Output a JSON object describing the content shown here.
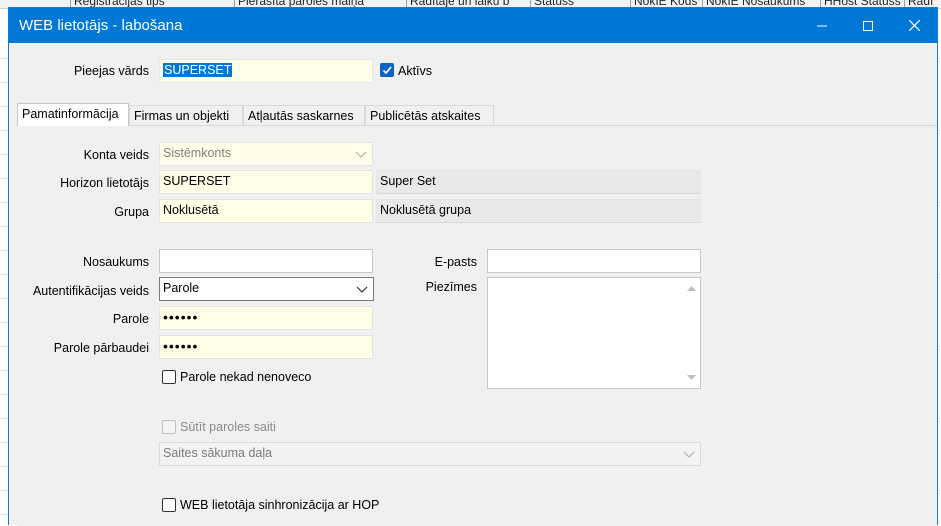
{
  "background": {
    "columns": [
      "Reģistrācijas tips",
      "Pierasītā paroles maiņa",
      "Rādītāje un laiku b",
      "Statuss",
      "NokIE Kods",
      "NokIE Nosaukums",
      "HHost Statuss",
      "Rādī"
    ]
  },
  "window": {
    "title": "WEB lietotājs - labošana"
  },
  "header": {
    "username_label": "Pieejas vārds",
    "username_value": "SUPERSET",
    "active_label": "Aktīvs",
    "active_checked": true
  },
  "tabs": [
    {
      "label": "Pamatinformācija",
      "active": true
    },
    {
      "label": "Firmas un objekti",
      "active": false
    },
    {
      "label": "Atļautās saskarnes",
      "active": false
    },
    {
      "label": "Publicētās atskaites",
      "active": false
    }
  ],
  "form": {
    "account_type_label": "Konta veids",
    "account_type_value": "Sistēmkonts",
    "horizon_user_label": "Horizon lietotājs",
    "horizon_user_code": "SUPERSET",
    "horizon_user_name": "Super Set",
    "group_label": "Grupa",
    "group_code": "Noklusētā",
    "group_name": "Noklusētā grupa",
    "name_label": "Nosaukums",
    "name_value": "",
    "email_label": "E-pasts",
    "email_value": "",
    "auth_label": "Autentifikācijas veids",
    "auth_value": "Parole",
    "notes_label": "Piezīmes",
    "password_label": "Parole",
    "password_value": "••••••",
    "password_confirm_label": "Parole pārbaudei",
    "password_confirm_value": "••••••",
    "never_expire_label": "Parole nekad nenoveco",
    "send_link_label": "Sūtīt paroles saiti",
    "start_page_placeholder": "Saites sākuma daļa",
    "sync_label": "WEB lietotāja sinhronizācija ar HOP"
  },
  "colors": {
    "titlebar": "#0078d7",
    "required_field": "#fffee6",
    "accent": "#0a64c8"
  }
}
